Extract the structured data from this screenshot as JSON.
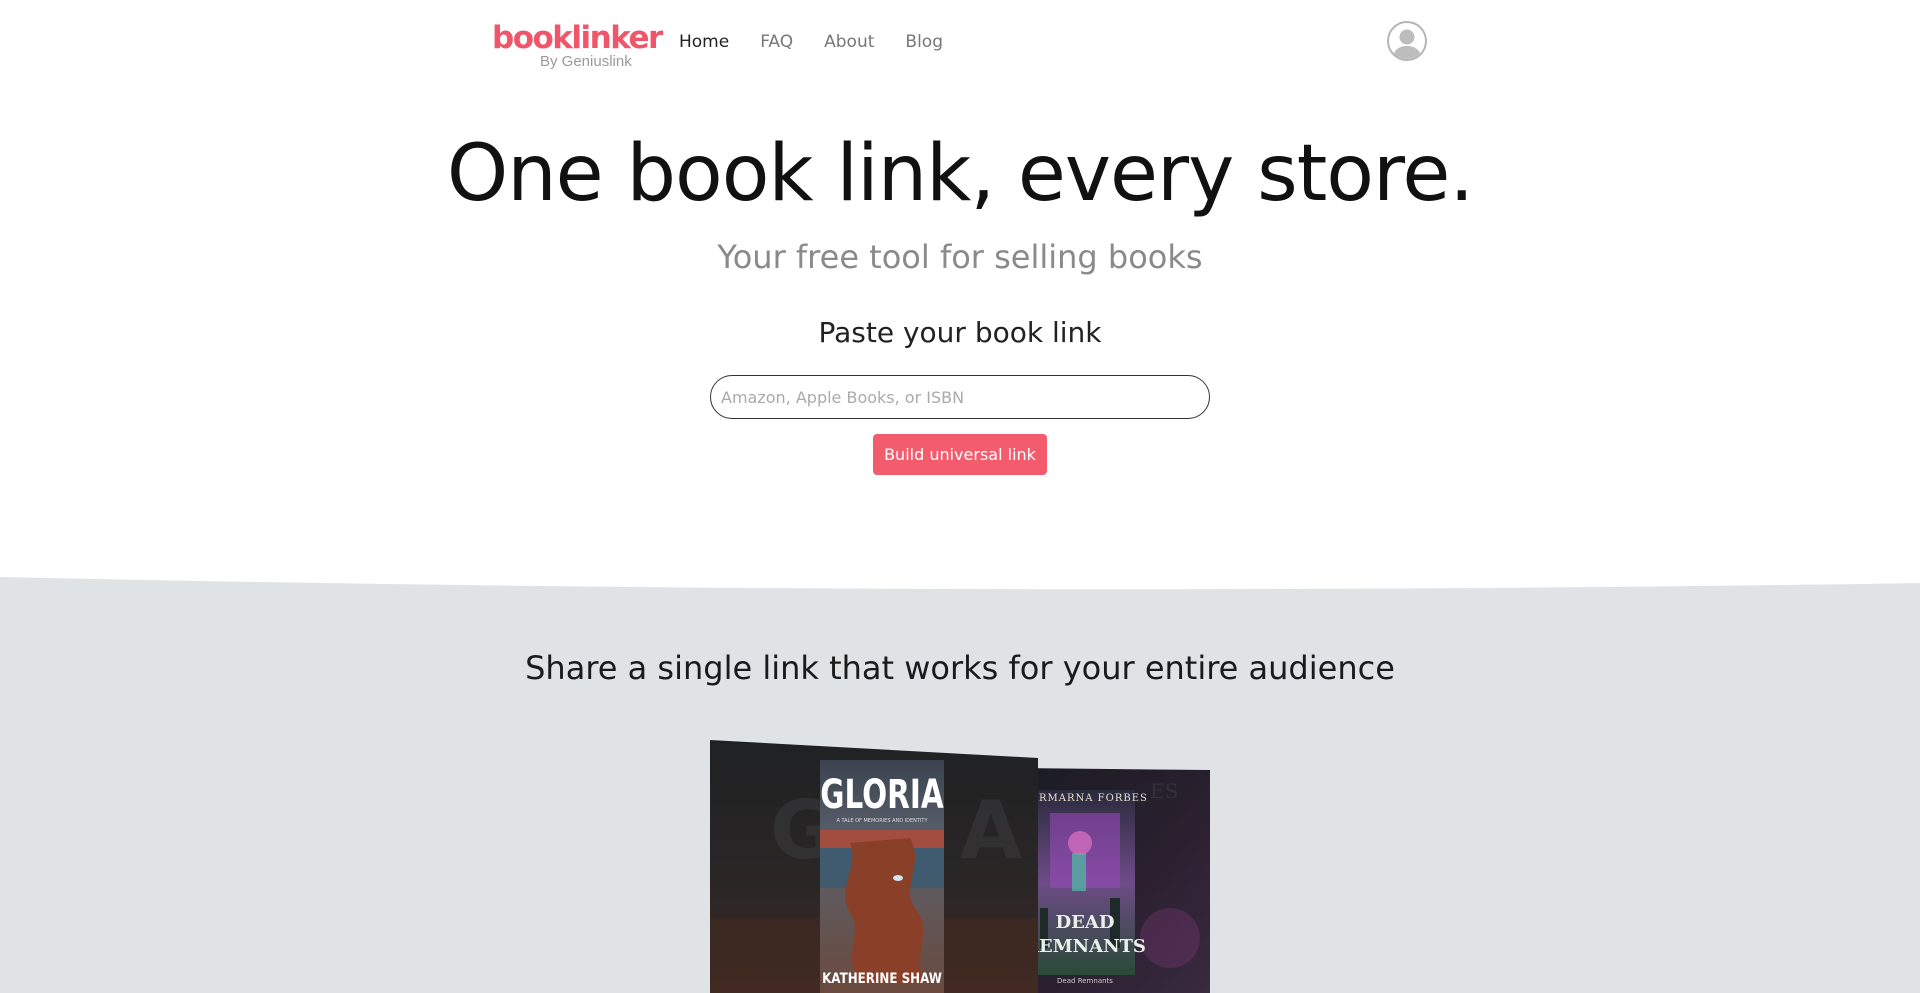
{
  "header": {
    "logo_text": "booklinker",
    "logo_sub": "By Geniuslink",
    "nav": [
      {
        "label": "Home",
        "active": true
      },
      {
        "label": "FAQ",
        "active": false
      },
      {
        "label": "About",
        "active": false
      },
      {
        "label": "Blog",
        "active": false
      }
    ],
    "avatar_icon": "user-avatar-icon"
  },
  "hero": {
    "title": "One book link, every store.",
    "subtitle": "Your free tool for selling books",
    "paste_label": "Paste your book link",
    "input_placeholder": "Amazon, Apple Books, or ISBN",
    "input_value": "",
    "button_label": "Build universal link"
  },
  "showcase": {
    "title": "Share a single link that works for your entire audience",
    "books": [
      {
        "title": "GLORIA",
        "author": "KATHERINE SHAW"
      },
      {
        "title": "DEAD REMNANTS",
        "author": "CARMARNA FORBES",
        "caption": "Dead Remnants"
      }
    ]
  },
  "colors": {
    "brand": "#f0566a",
    "button": "#f35c6d",
    "section_bg": "#e0e3e6",
    "text_muted": "#8a8a8a"
  }
}
